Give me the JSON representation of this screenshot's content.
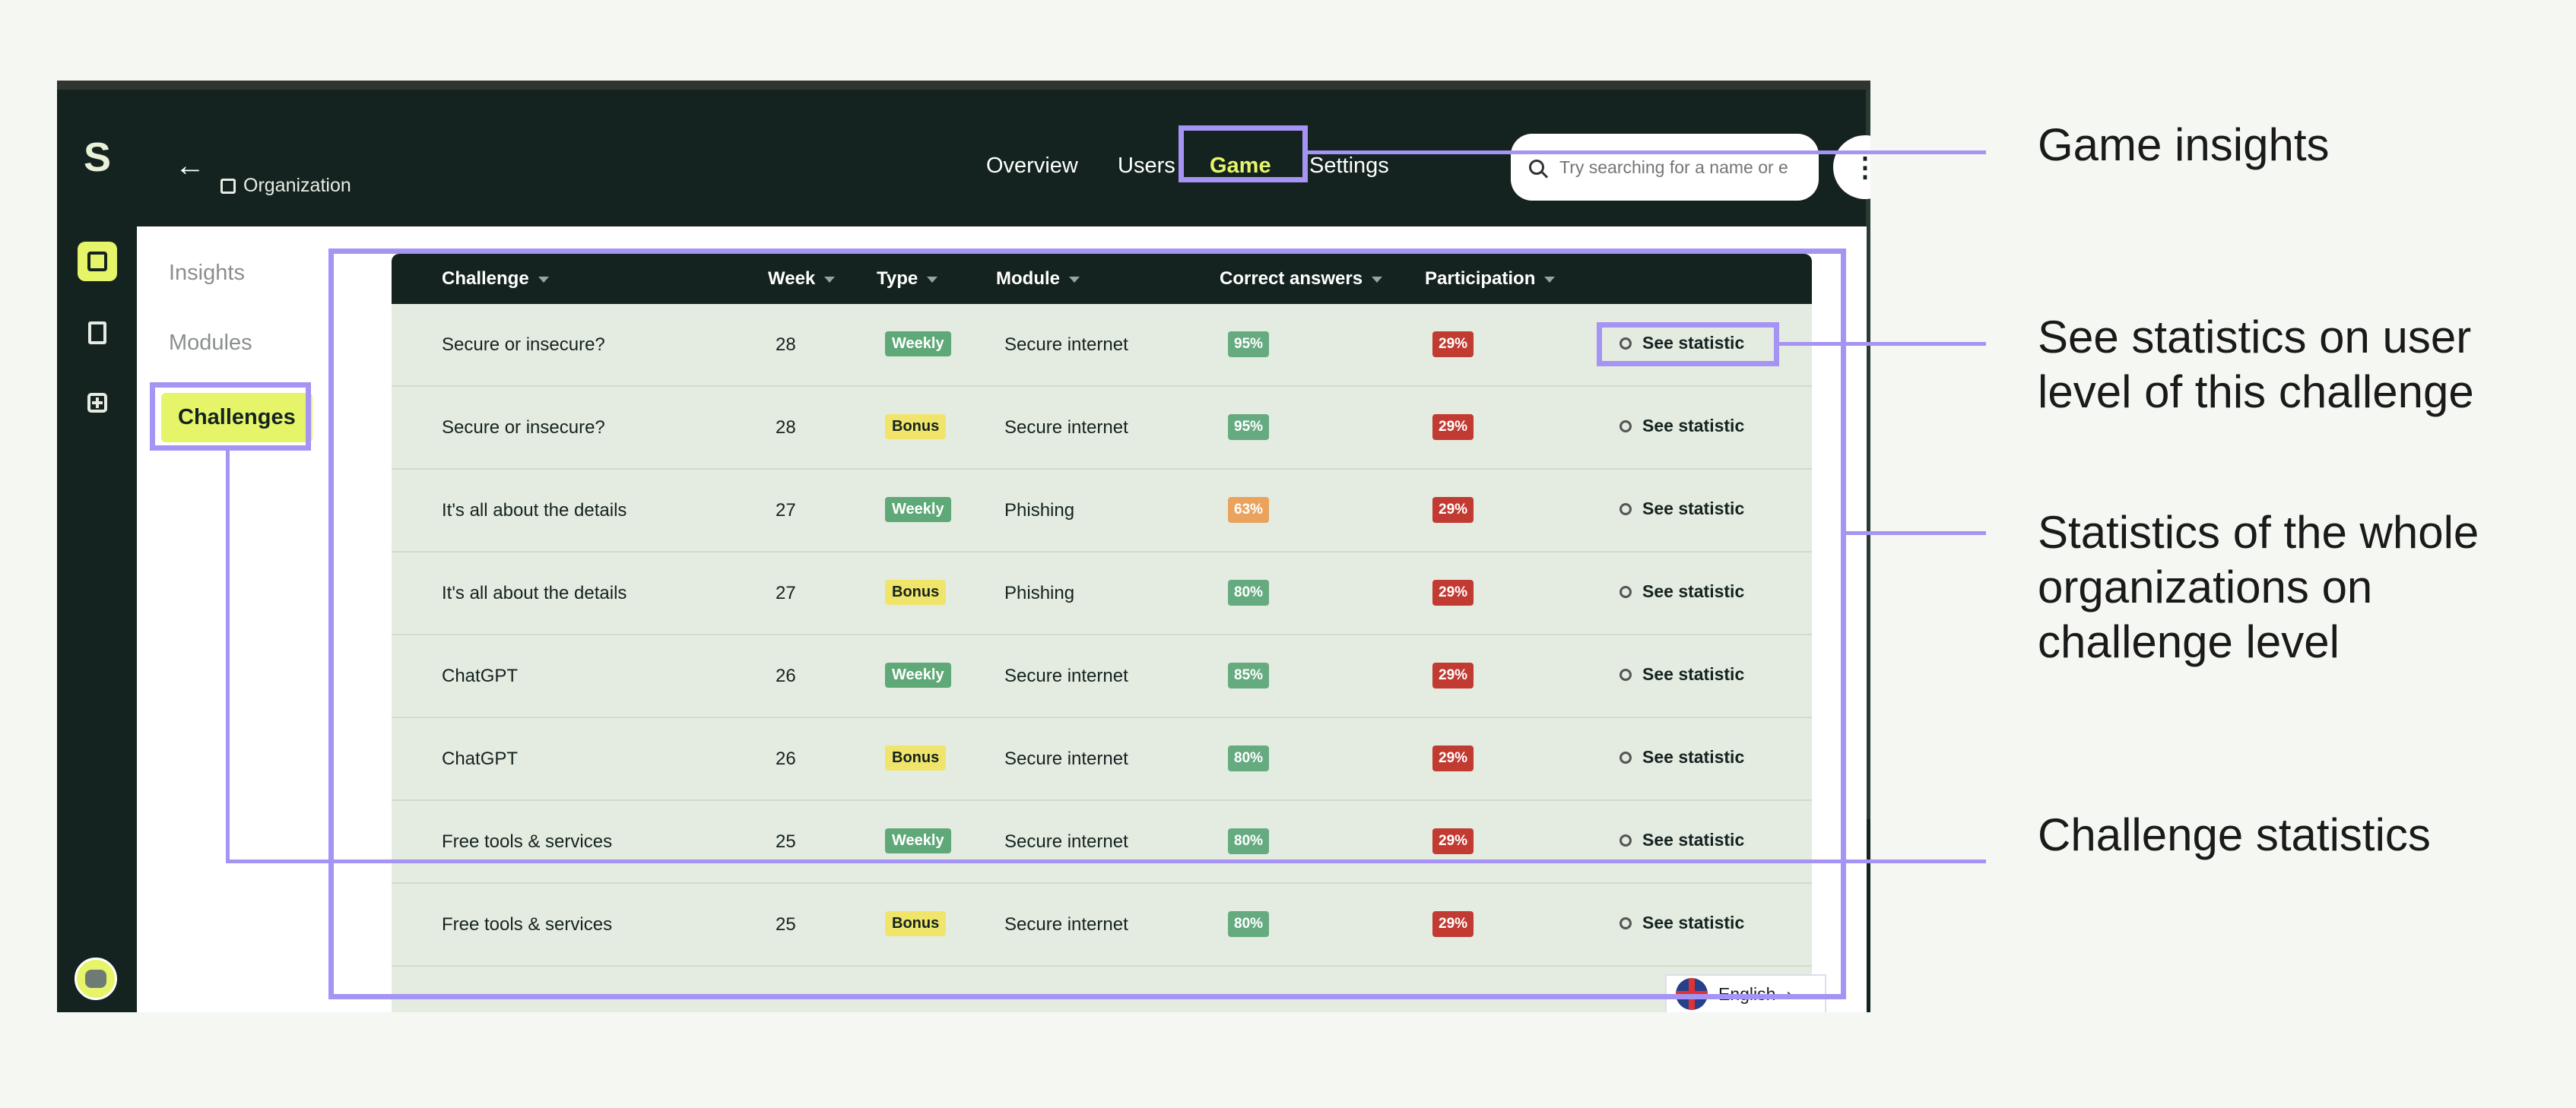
{
  "nav": {
    "back_icon": "arrow-left-icon",
    "org_label": "Organization",
    "tabs": [
      {
        "label": "Overview"
      },
      {
        "label": "Users"
      },
      {
        "label": "Game"
      },
      {
        "label": "Settings"
      }
    ]
  },
  "search": {
    "placeholder": "Try searching for a name or e"
  },
  "subnav": [
    "Insights",
    "Modules",
    "Challenges"
  ],
  "table": {
    "columns": [
      "Challenge",
      "Week",
      "Type",
      "Module",
      "Correct answers",
      "Participation"
    ],
    "rows": [
      {
        "challenge": "Secure or insecure?",
        "week": "28",
        "type": "Weekly",
        "module": "Secure internet",
        "correct": "95%",
        "participation": "29%",
        "action": "See statistic"
      },
      {
        "challenge": "Secure or insecure?",
        "week": "28",
        "type": "Bonus",
        "module": "Secure internet",
        "correct": "95%",
        "participation": "29%",
        "action": "See statistic"
      },
      {
        "challenge": "It's all about the details",
        "week": "27",
        "type": "Weekly",
        "module": "Phishing",
        "correct": "63%",
        "participation": "29%",
        "action": "See statistic"
      },
      {
        "challenge": "It's all about the details",
        "week": "27",
        "type": "Bonus",
        "module": "Phishing",
        "correct": "80%",
        "participation": "29%",
        "action": "See statistic"
      },
      {
        "challenge": "ChatGPT",
        "week": "26",
        "type": "Weekly",
        "module": "Secure internet",
        "correct": "85%",
        "participation": "29%",
        "action": "See statistic"
      },
      {
        "challenge": "ChatGPT",
        "week": "26",
        "type": "Bonus",
        "module": "Secure internet",
        "correct": "80%",
        "participation": "29%",
        "action": "See statistic"
      },
      {
        "challenge": "Free tools & services",
        "week": "25",
        "type": "Weekly",
        "module": "Secure internet",
        "correct": "80%",
        "participation": "29%",
        "action": "See statistic"
      },
      {
        "challenge": "Free tools & services",
        "week": "25",
        "type": "Bonus",
        "module": "Secure internet",
        "correct": "80%",
        "participation": "29%",
        "action": "See statistic"
      }
    ]
  },
  "language": {
    "label": "English"
  },
  "callouts": {
    "game": "Game insights",
    "user_level": [
      "See statistics on user",
      "level of this challenge"
    ],
    "org_level": [
      "Statistics of the whole",
      "organizations on",
      "challenge level"
    ],
    "challenge": "Challenge statistics"
  },
  "colors": {
    "accent": "#e6f46a",
    "dark": "#14231f",
    "annotation": "#a594f3"
  }
}
